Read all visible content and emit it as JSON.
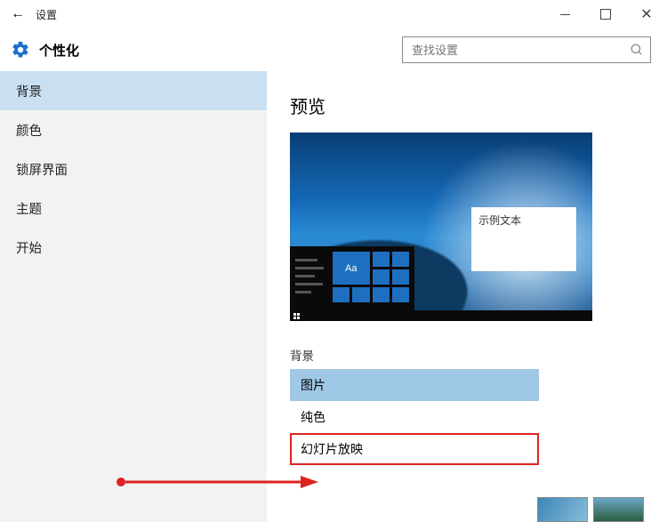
{
  "window": {
    "title": "设置"
  },
  "header": {
    "title": "个性化",
    "search_placeholder": "查找设置"
  },
  "sidebar": {
    "items": [
      {
        "label": "背景",
        "selected": true
      },
      {
        "label": "颜色"
      },
      {
        "label": "锁屏界面"
      },
      {
        "label": "主题"
      },
      {
        "label": "开始"
      }
    ]
  },
  "content": {
    "preview_heading": "预览",
    "sample_text": "示例文本",
    "aa_tile": "Aa",
    "bg_label": "背景",
    "bg_options": [
      {
        "label": "图片",
        "selected": true
      },
      {
        "label": "纯色"
      },
      {
        "label": "幻灯片放映",
        "highlight": true
      }
    ]
  }
}
